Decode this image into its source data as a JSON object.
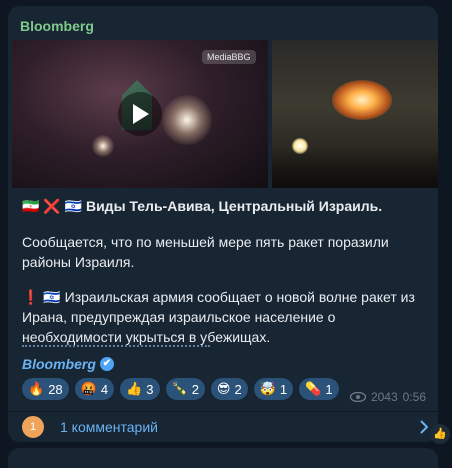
{
  "channel": {
    "name": "Bloomberg"
  },
  "media": {
    "watermark": "MediaBBG",
    "left_video": {
      "has_play_button": true
    },
    "right_image": {}
  },
  "post": {
    "headline_prefix": "🇮🇷 ❌ 🇮🇱",
    "headline": "Виды Тель-Авива, Центральный Израиль.",
    "paragraph1": "Сообщается, что по меньшей мере пять ракет поразили районы Израиля.",
    "paragraph2_prefix": "❗️ 🇮🇱",
    "paragraph2": "Израильская армия сообщает о новой волне ракет из Ирана, предупреждая израильское население о необходимости укрыться в убежищах.",
    "signature": "Bloomberg",
    "signature_verified_icon": "✔"
  },
  "reactions": [
    {
      "emoji": "🔥",
      "count": "28"
    },
    {
      "emoji": "🤬",
      "count": "4"
    },
    {
      "emoji": "👍",
      "count": "3"
    },
    {
      "emoji": "🍾",
      "count": "2"
    },
    {
      "emoji": "😎",
      "count": "2"
    },
    {
      "emoji": "🤯",
      "count": "1"
    },
    {
      "emoji": "💊",
      "count": "1"
    }
  ],
  "meta": {
    "views": "2043",
    "time": "0:56",
    "views_icon": "eye-icon"
  },
  "comments": {
    "avatar_initial": "1",
    "label": "1 комментарий"
  },
  "share": {
    "icon": "👍"
  },
  "colors": {
    "background": "#0e1621",
    "card": "#182533",
    "channel_name": "#7fc98b",
    "link": "#6ab3f3",
    "reaction_bg": "#2b5278"
  }
}
